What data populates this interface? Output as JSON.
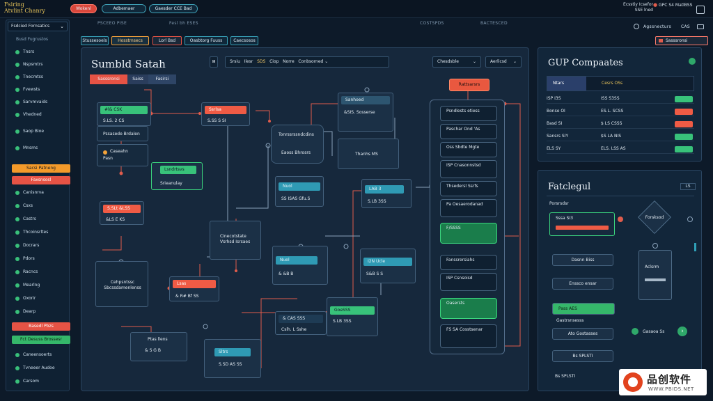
{
  "brand": {
    "line1": "Fsiring",
    "line2": "Atvlint Chanry"
  },
  "topbar": {
    "pills": [
      "Wokenl",
      "Adbemaer",
      "Gaesder CCE Bad"
    ],
    "user_line1": "Ecsstiy Icsefor",
    "user_line2": "SSE lned",
    "user_line3": "GPC S4 MatlBSS"
  },
  "subheader": {
    "left": "PSCEEO PISE",
    "mid": "Fesl bh ESES",
    "right1": "COSTSPDS",
    "right2": "BACTESCED",
    "search": "Agssnecturs",
    "cog": "CAS"
  },
  "sidebar": {
    "head": "Fsdcied Fornsatics",
    "items": [
      "Busd Fugrustos",
      "Tnsrs",
      "Nspsmtrs",
      "Tnecmtss",
      "Fvewsts",
      "Sarvmvaids",
      "Vhedned",
      "Saop Bioe",
      "Mnsms"
    ],
    "pill_orange": "Sacsi Patneng",
    "pill_red": "Faxsnsosl",
    "items2": [
      "Canisnrva",
      "Csxs",
      "Castrs",
      "Thcoinsrltes",
      "Docrars",
      "Pdors",
      "Racncs",
      "Mearlng",
      "Oxorir",
      "Dearp"
    ],
    "pill_red2": "Basedl Pbzs",
    "pill_green": "Fct Desuss Brossesr",
    "items3": [
      "Caneensoerts",
      "Tvneeer Audoe",
      "Carsom"
    ]
  },
  "toolbar": [
    "Stussesoels",
    "Hosstmsecs",
    "Lorl Bsd",
    "Oasbtorg Fuuss",
    "Caecsosos"
  ],
  "canvas": {
    "title": "Sumbld Satah",
    "controls": [
      "Srsiu",
      "Ilesr",
      "SDS",
      "Ciop",
      "Norre",
      "Conbsorned"
    ],
    "seg": [
      "Sasssronsi",
      "Saiss",
      "Fasirsi"
    ],
    "dropdown1": "Chesdsble",
    "dropdown2": "Aerlicsd",
    "nodes": {
      "n1_bar": "#l& CSK",
      "n1_line": "S.LS. 2 CS",
      "n2": "Pssasede Brdalen",
      "n3a": "Caseahn",
      "n3b": "Pasn",
      "n4_bar": "Ssrlsa",
      "n4_line": "S.SS S SI",
      "n5_bar": "Lsndrtsvs",
      "n5_line": "Srieanulay",
      "n6_bar": "S.SLt &LSS",
      "n6_line": "&LS E KS",
      "n7": "Cehpsntssc Sbcssdamenlenss",
      "n8_bar": "Lsas",
      "n8_line": "& R# Bf SS",
      "n9_bar": "Ptas llens",
      "n9_line": "& S G B",
      "n10_bar": "& CAS SSS",
      "n10_line": "Cslh. L Sshe",
      "n11": "Tonrssrssndcdins",
      "n11b": "Eaoss Bhrosrs",
      "n12": "Thanhs MS",
      "n13": "Cinecotstate",
      "n13b": "Vsrhsd Isrsaes",
      "n14_bar": "Sanhoed",
      "n14_line": "&SIS. Sosserse",
      "n15_bar": "Nuol",
      "n15_line": "SS ISAS Gfu.S",
      "n16_bar": "LAB 3",
      "n16_line": "S.LB 3SS",
      "n17_bar": "I2N Ucle",
      "n17_line": "& &B B",
      "n18_bar": "GoeSSS",
      "n18_line": "S&B S S",
      "n19_bar": "Sltrs",
      "n19_line": "S.SD AS SS"
    },
    "column_header": "Rattsarsrs",
    "column_rows": [
      "Psndlests etiess",
      "Paschar Ond 'As",
      "Oss Sbdte Mgte",
      "ISP Cnasonnstsd",
      "Thsedersl Ssrfs",
      "Pa Oesaerodanad",
      "F/SSSS",
      "Fanssrersiahs",
      "ISP Csnsoisd",
      "Oasersts",
      "FS SA Cosstsenar"
    ]
  },
  "panel1": {
    "title": "GUP Compaates",
    "head_left": "Ntars",
    "head_right": "Cesrs OSs",
    "rows": [
      {
        "a": "ISP I3S",
        "b": "ISS S3SS"
      },
      {
        "a": "Bonse OI",
        "b": "ES.L. SCSS"
      },
      {
        "a": "Basd SI",
        "b": "$ LS CSSS"
      },
      {
        "a": "Sansrs SIY",
        "b": "$S LA NIS"
      },
      {
        "a": "ELS SY",
        "b": "ELS. LSS AS"
      }
    ]
  },
  "panel2": {
    "title": "Fatclegul",
    "badge": "LS",
    "head": "Porsrsdsr",
    "rows": [
      "Sssa SI3",
      "Dasnn Biss",
      "Enssco ensar",
      "Pass AES",
      "Gastrsnsesss",
      "Ato Gostasses",
      "Bs SPLSTI"
    ],
    "diamond": "Forsksod",
    "side": "Aclsrm",
    "action": "Gasaoa Ss"
  },
  "watermark": {
    "cn": "品创软件",
    "en": "WWW.PBIDS.NET"
  }
}
